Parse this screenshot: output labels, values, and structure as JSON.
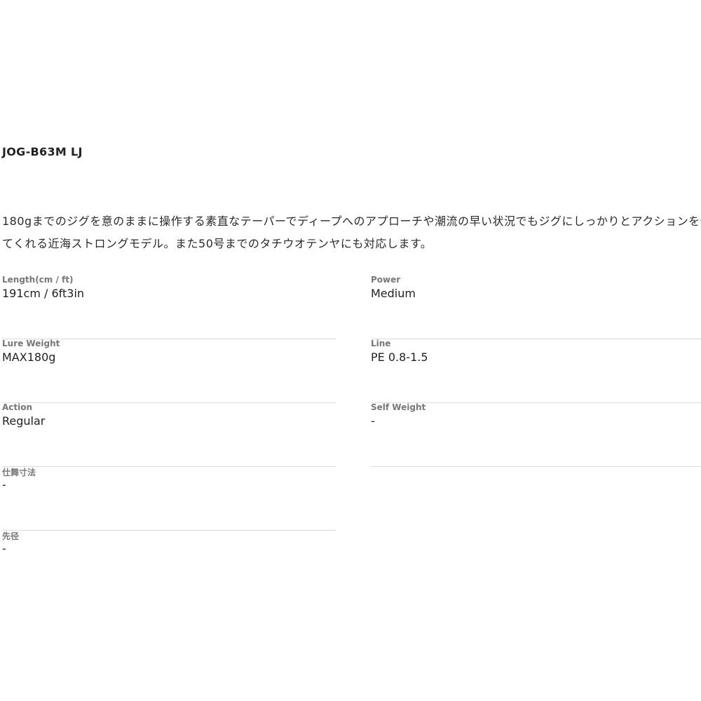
{
  "product": {
    "model": "JOG-B63M LJ",
    "description": "180gまでのジグを意のままに操作する素直なテーパーでディープへのアプローチや潮流の早い状況でもジグにしっかりとアクションを伝えてくれる近海ストロングモデル。また50号までのタチウオテンヤにも対応します。"
  },
  "specs": {
    "length": {
      "label": "Length(cm / ft)",
      "value": "191cm / 6ft3in"
    },
    "power": {
      "label": "Power",
      "value": "Medium"
    },
    "lure_weight": {
      "label": "Lure Weight",
      "value": "MAX180g"
    },
    "line": {
      "label": "Line",
      "value": "PE 0.8-1.5"
    },
    "action": {
      "label": "Action",
      "value": "Regular"
    },
    "self_weight": {
      "label": "Self Weight",
      "value": "-"
    },
    "shimai": {
      "label": "仕舞寸法",
      "value": "-"
    },
    "tip_diameter": {
      "label": "先径",
      "value": "-"
    }
  }
}
